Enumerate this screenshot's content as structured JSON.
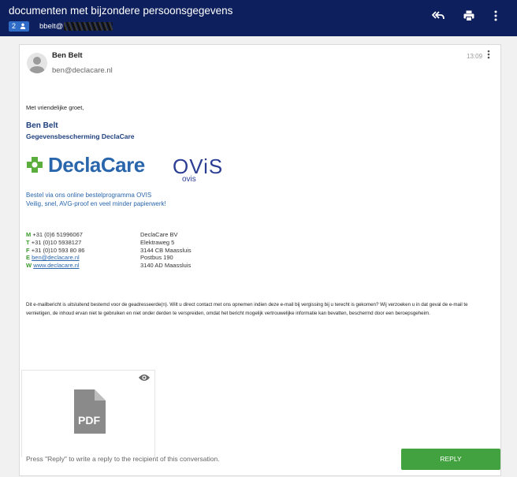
{
  "header": {
    "title": "documenten met bijzondere persoonsgegevens",
    "recipient_count": "2",
    "recipient_prefix": "bbelt@",
    "bg_color": "#0d1f5c"
  },
  "message": {
    "sender_name": "Ben Belt",
    "sender_email": "ben@declacare.nl",
    "time": "13:09",
    "greeting": "Met vriendelijke groet,",
    "signature": {
      "name": "Ben Belt",
      "department": "Gegevensbescherming DeclaCare",
      "logo_declacare": "DeclaCare",
      "logo_ovis": "OViS",
      "logo_ovis_sub": "ovis",
      "promo_line1": "Bestel via ons online bestelprogramma OVIS",
      "promo_line2": "Veilig, snel, AVG-proof en veel minder papierwerk!",
      "contact": {
        "m_label": "M",
        "m_value": "+31 (0)6 51996067",
        "t_label": "T",
        "t_value": "+31 (0)10 5938127",
        "f_label": "F",
        "f_value": "+31 (0)10 593 80 86",
        "e_label": "E",
        "e_value": "ben@declacare.nl",
        "w_label": "W",
        "w_value": "www.declacare.nl"
      },
      "address": {
        "line1": "DeclaCare BV",
        "line2": "Elektraweg 5",
        "line3": "3144 CB Maassluis",
        "line4": "Postbus 190",
        "line5": "3140 AD Maassluis"
      }
    },
    "disclaimer": "Dit e-mailbericht is uitsluitend bestemd voor de geadresseerde(n). Wilt u direct contact met ons opnemen indien deze e-mail bij vergissing bij u terecht is gekomen? Wij verzoeken u in dat geval de e-mail te vernietigen, de inhoud ervan niet te gebruiken en niet onder derden te verspreiden, omdat het bericht mogelijk vertrouwelijke informatie kan bevatten, beschermd door een beroepsgeheim.",
    "attachment": {
      "type_label": "PDF",
      "preview_icon": "eye-icon"
    }
  },
  "reply": {
    "hint": "Press \"Reply\" to write a reply to the recipient of this conversation.",
    "button_label": "REPLY"
  },
  "colors": {
    "accent_green": "#43a240",
    "brand_blue": "#2a66ac"
  }
}
